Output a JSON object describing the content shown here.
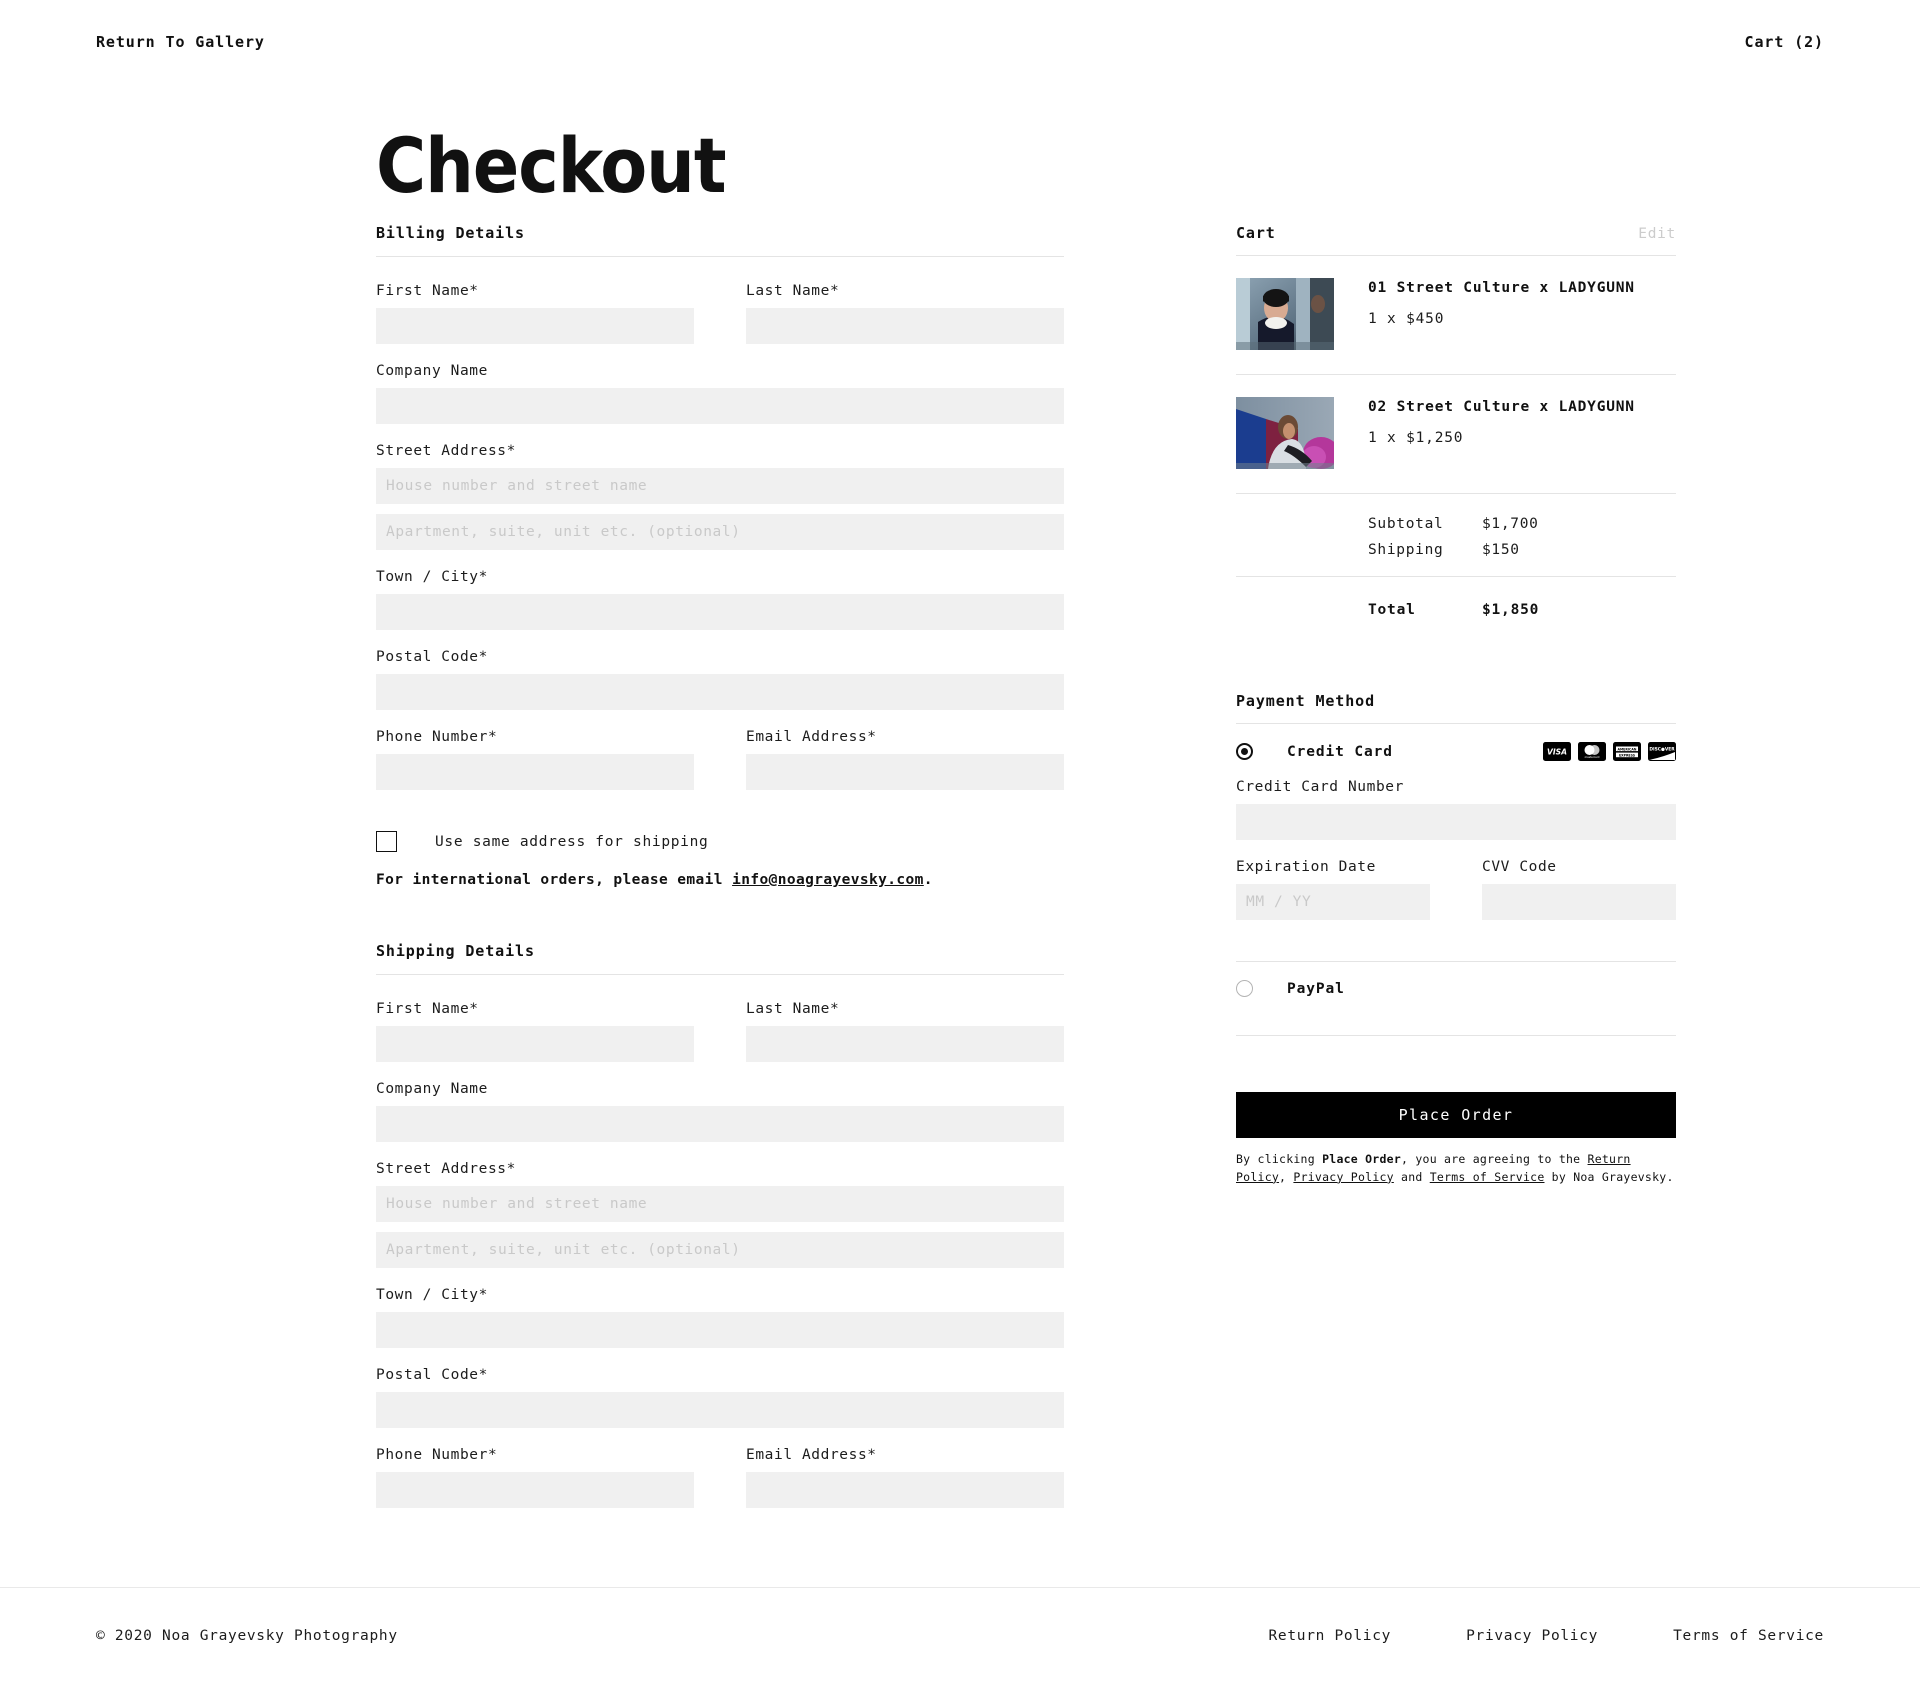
{
  "header": {
    "return_link": "Return To Gallery",
    "cart_link": "Cart (2)"
  },
  "page_title": "Checkout",
  "billing": {
    "heading": "Billing Details",
    "first_name_label": "First Name*",
    "last_name_label": "Last Name*",
    "company_label": "Company Name",
    "street_label": "Street Address*",
    "street_placeholder": "House number and street name",
    "street2_placeholder": "Apartment, suite, unit etc. (optional)",
    "town_label": "Town / City*",
    "postal_label": "Postal Code*",
    "phone_label": "Phone Number*",
    "email_label": "Email Address*",
    "same_address_label": "Use same address for shipping",
    "intl_prefix": "For international orders, please email ",
    "intl_email": "info@noagrayevsky.com",
    "intl_suffix": "."
  },
  "shipping": {
    "heading": "Shipping Details",
    "first_name_label": "First Name*",
    "last_name_label": "Last Name*",
    "company_label": "Company Name",
    "street_label": "Street Address*",
    "street_placeholder": "House number and street name",
    "street2_placeholder": "Apartment, suite, unit etc. (optional)",
    "town_label": "Town / City*",
    "postal_label": "Postal Code*",
    "phone_label": "Phone Number*",
    "email_label": "Email Address*"
  },
  "cart": {
    "title": "Cart",
    "edit_label": "Edit",
    "items": [
      {
        "name": "01 Street Culture x LADYGUNN",
        "qty_price": "1 x $450"
      },
      {
        "name": "02 Street Culture x LADYGUNN",
        "qty_price": "1 x $1,250"
      }
    ],
    "subtotal_label": "Subtotal",
    "subtotal_value": "$1,700",
    "shipping_label": "Shipping",
    "shipping_value": "$150",
    "total_label": "Total",
    "total_value": "$1,850"
  },
  "payment": {
    "heading": "Payment Method",
    "credit_card_label": "Credit Card",
    "card_number_label": "Credit Card Number",
    "expiration_label": "Expiration Date",
    "expiration_placeholder": "MM / YY",
    "cvv_label": "CVV Code",
    "paypal_label": "PayPal",
    "card_brands": [
      "visa",
      "mastercard",
      "american-express",
      "discover"
    ],
    "place_order_label": "Place Order",
    "disclaimer": {
      "part1": "By clicking ",
      "bold": "Place Order",
      "part2": ", you are agreeing to the ",
      "link1": "Return Policy",
      "part3": ", ",
      "link2": "Privacy Policy",
      "part4": " and ",
      "link3": "Terms of Service",
      "part5": " by Noa Grayevsky."
    }
  },
  "footer": {
    "copyright": "© 2020 Noa Grayevsky Photography",
    "links": [
      "Return Policy",
      "Privacy Policy",
      "Terms of Service"
    ]
  },
  "colors": {
    "accent": "#000000",
    "field_bg": "#f0f0f0",
    "divider": "#e4e4e4",
    "muted": "#cccccc"
  }
}
